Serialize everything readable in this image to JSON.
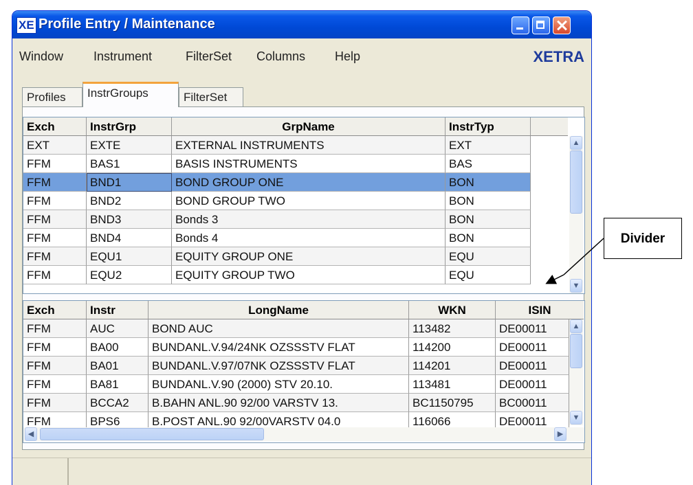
{
  "window": {
    "icon": "XE",
    "title": "Profile Entry / Maintenance"
  },
  "menu": {
    "items": [
      "Window",
      "Instrument",
      "FilterSet",
      "Columns",
      "Help"
    ],
    "brand": "XETRA"
  },
  "tabs": [
    "Profiles",
    "InstrGroups",
    "FilterSet"
  ],
  "active_tab": "InstrGroups",
  "groups_table": {
    "columns": [
      "Exch",
      "InstrGrp",
      "GrpName",
      "InstrTyp"
    ],
    "rows": [
      [
        "EXT",
        "EXTE",
        "EXTERNAL INSTRUMENTS",
        "EXT"
      ],
      [
        "FFM",
        "BAS1",
        "BASIS INSTRUMENTS",
        "BAS"
      ],
      [
        "FFM",
        "BND1",
        "BOND GROUP ONE",
        "BON"
      ],
      [
        "FFM",
        "BND2",
        "BOND GROUP TWO",
        "BON"
      ],
      [
        "FFM",
        "BND3",
        "Bonds 3",
        "BON"
      ],
      [
        "FFM",
        "BND4",
        "Bonds 4",
        "BON"
      ],
      [
        "FFM",
        "EQU1",
        "EQUITY GROUP ONE",
        "EQU"
      ],
      [
        "FFM",
        "EQU2",
        "EQUITY GROUP TWO",
        "EQU"
      ]
    ],
    "selected_row": 2
  },
  "instruments_table": {
    "columns": [
      "Exch",
      "Instr",
      "LongName",
      "WKN",
      "ISIN"
    ],
    "rows": [
      [
        "FFM",
        "AUC",
        "BOND AUC",
        "113482",
        "DE00011"
      ],
      [
        "FFM",
        "BA00",
        "BUNDANL.V.94/24NK OZSSSTV FLAT",
        "114200",
        "DE00011"
      ],
      [
        "FFM",
        "BA01",
        "BUNDANL.V.97/07NK OZSSSTV FLAT",
        "114201",
        "DE00011"
      ],
      [
        "FFM",
        "BA81",
        "BUNDANL.V.90 (2000) STV 20.10.",
        "113481",
        "DE00011"
      ],
      [
        "FFM",
        "BCCA2",
        "B.BAHN ANL.90 92/00 VARSTV 13.",
        "BC1150795",
        "BC00011"
      ],
      [
        "FFM",
        "BPS6",
        "B.POST ANL.90 92/00VARSTV 04.0",
        "116066",
        "DE00011"
      ]
    ]
  },
  "annotation": {
    "label": "Divider"
  },
  "colors": {
    "title_bar": "#0049d6",
    "selection": "#729fdd",
    "active_tab_accent": "#f3a33c",
    "brand": "#1e3b9c"
  },
  "icons": {
    "scroll_up": "chevron-up-icon",
    "scroll_down": "chevron-down-icon",
    "scroll_left": "chevron-left-icon",
    "scroll_right": "chevron-right-icon"
  }
}
